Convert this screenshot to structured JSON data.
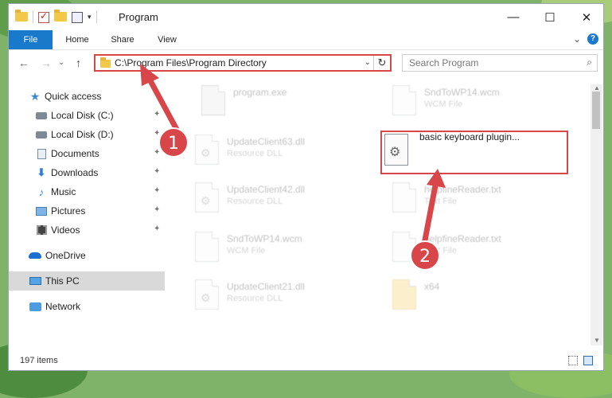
{
  "window": {
    "title": "Program",
    "minimize": "—",
    "maximize": "☐",
    "close": "✕"
  },
  "ribbon": {
    "tabs": [
      "File",
      "Home",
      "Share",
      "View"
    ],
    "expand_glyph": "⌄",
    "help_glyph": "?"
  },
  "nav": {
    "back_glyph": "←",
    "forward_glyph": "→",
    "recent_glyph": "⌄",
    "up_glyph": "↑"
  },
  "address": {
    "path": "C:\\Program Files\\Program Directory",
    "dropdown_glyph": "⌄",
    "refresh_glyph": "↻"
  },
  "search": {
    "placeholder": "Search Program",
    "icon_glyph": "⌕"
  },
  "sidebar": {
    "items": [
      {
        "label": "Quick access",
        "icon": "star-icon",
        "pinned": false
      },
      {
        "label": "Local Disk (C:)",
        "icon": "disk-icon",
        "pinned": true
      },
      {
        "label": "Local Disk (D:)",
        "icon": "disk-icon",
        "pinned": true
      },
      {
        "label": "Documents",
        "icon": "documents-icon",
        "pinned": true
      },
      {
        "label": "Downloads",
        "icon": "downloads-icon",
        "pinned": true
      },
      {
        "label": "Music",
        "icon": "music-icon",
        "pinned": true
      },
      {
        "label": "Pictures",
        "icon": "pictures-icon",
        "pinned": true
      },
      {
        "label": "Videos",
        "icon": "videos-icon",
        "pinned": true
      },
      {
        "label": "OneDrive",
        "icon": "onedrive-icon",
        "pinned": false
      },
      {
        "label": "This PC",
        "icon": "this-pc-icon",
        "pinned": false,
        "selected": true
      },
      {
        "label": "Network",
        "icon": "network-icon",
        "pinned": false
      }
    ],
    "pin_glyph": "📌"
  },
  "files": [
    {
      "name": "program.exe",
      "type": "",
      "icon": "exe-icon"
    },
    {
      "name": "SndToWP14.wcm",
      "type": "WCM File",
      "icon": "file-icon"
    },
    {
      "name": "UpdateClient63.dll",
      "type": "Resource DLL",
      "icon": "dll-icon"
    },
    {
      "name": "UpdateClient42.dll",
      "type": "Resource DLL",
      "icon": "dll-icon"
    },
    {
      "name": "helpfineReader.txt",
      "type": "Text File",
      "icon": "file-icon"
    },
    {
      "name": "SndToWP14.wcm",
      "type": "WCM File",
      "icon": "file-icon"
    },
    {
      "name": "helpfineReader.txt",
      "type": "Text File",
      "icon": "file-icon"
    },
    {
      "name": "UpdateClient21.dll",
      "type": "Resource DLL",
      "icon": "dll-icon"
    },
    {
      "name": "x64",
      "type": "",
      "icon": "folder-icon"
    }
  ],
  "highlighted_file": {
    "name": "basic keyboard plugin...",
    "icon": "dll-gear-icon"
  },
  "status": {
    "item_count": "197 items"
  },
  "callouts": [
    "1",
    "2"
  ],
  "colors": {
    "accent": "#1979ca",
    "highlight": "#d9464a"
  }
}
